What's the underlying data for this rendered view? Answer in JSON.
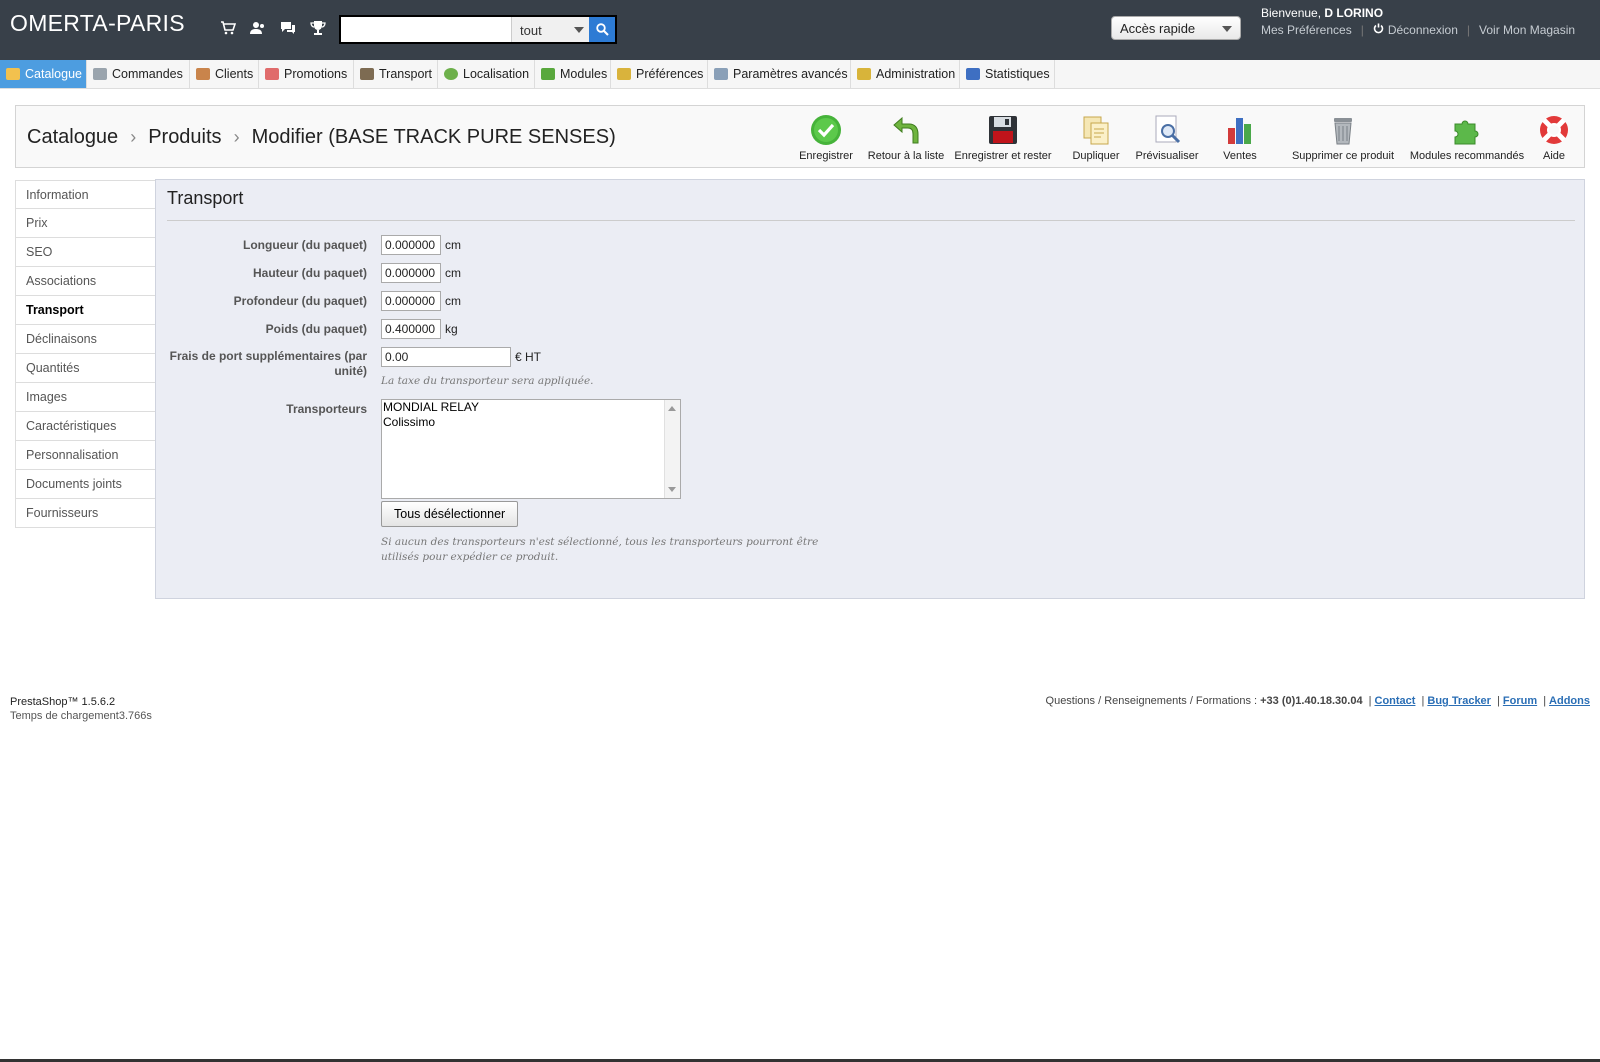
{
  "header": {
    "shop_name": "OMERTA-PARIS",
    "search_placeholder": "",
    "search_scope": "tout",
    "quick_access": "Accès rapide",
    "welcome_prefix": "Bienvenue, ",
    "user_name": "D LORINO",
    "prefs_link": "Mes Préférences",
    "logout_link": "Déconnexion",
    "shop_link": "Voir Mon Magasin",
    "icons": [
      "cart-icon",
      "customers-icon",
      "messages-icon",
      "trophy-icon"
    ]
  },
  "nav": {
    "items": [
      {
        "label": "Catalogue",
        "icon": "folder-icon",
        "color": "#f2c14e"
      },
      {
        "label": "Commandes",
        "icon": "cart-icon",
        "color": "#9aa4ad"
      },
      {
        "label": "Clients",
        "icon": "user-icon",
        "color": "#c9844b"
      },
      {
        "label": "Promotions",
        "icon": "tag-icon",
        "color": "#e06b6b"
      },
      {
        "label": "Transport",
        "icon": "truck-icon",
        "color": "#7d6b52"
      },
      {
        "label": "Localisation",
        "icon": "globe-icon",
        "color": "#6db04b"
      },
      {
        "label": "Modules",
        "icon": "puzzle-icon",
        "color": "#59a83d"
      },
      {
        "label": "Préférences",
        "icon": "wrench-icon",
        "color": "#d9b33c"
      },
      {
        "label": "Paramètres avancés",
        "icon": "tools-icon",
        "color": "#8aa0b8"
      },
      {
        "label": "Administration",
        "icon": "key-icon",
        "color": "#d8b43a"
      },
      {
        "label": "Statistiques",
        "icon": "chart-icon",
        "color": "#3e6fc2"
      }
    ]
  },
  "toolbar": {
    "breadcrumb": [
      "Catalogue",
      "Produits",
      "Modifier (BASE TRACK PURE SENSES)"
    ],
    "buttons": [
      {
        "label": "Enregistrer",
        "icon": "save-check-icon"
      },
      {
        "label": "Retour à la liste",
        "icon": "back-arrow-icon"
      },
      {
        "label": "Enregistrer et rester",
        "icon": "floppy-disk-icon"
      },
      {
        "label": "Dupliquer",
        "icon": "duplicate-icon"
      },
      {
        "label": "Prévisualiser",
        "icon": "preview-icon"
      },
      {
        "label": "Ventes",
        "icon": "sales-chart-icon"
      },
      {
        "label": "Supprimer ce produit",
        "icon": "trash-icon"
      },
      {
        "label": "Modules recommandés",
        "icon": "puzzle-icon"
      },
      {
        "label": "Aide",
        "icon": "lifebuoy-icon"
      }
    ]
  },
  "sidebar": {
    "items": [
      {
        "label": "Information"
      },
      {
        "label": "Prix"
      },
      {
        "label": "SEO"
      },
      {
        "label": "Associations"
      },
      {
        "label": "Transport"
      },
      {
        "label": "Déclinaisons"
      },
      {
        "label": "Quantités"
      },
      {
        "label": "Images"
      },
      {
        "label": "Caractéristiques"
      },
      {
        "label": "Personnalisation"
      },
      {
        "label": "Documents joints"
      },
      {
        "label": "Fournisseurs"
      }
    ],
    "active": "Transport"
  },
  "form": {
    "title": "Transport",
    "width_label": "Longueur (du paquet)",
    "width_value": "0.000000",
    "width_unit": "cm",
    "height_label": "Hauteur (du paquet)",
    "height_value": "0.000000",
    "height_unit": "cm",
    "depth_label": "Profondeur (du paquet)",
    "depth_value": "0.000000",
    "depth_unit": "cm",
    "weight_label": "Poids (du paquet)",
    "weight_value": "0.400000",
    "weight_unit": "kg",
    "extra_label": "Frais de port supplémentaires (par unité)",
    "extra_value": "0.00",
    "extra_unit": "€ HT",
    "extra_hint": "La taxe du transporteur sera appliquée.",
    "carriers_label": "Transporteurs",
    "carriers": [
      "MONDIAL RELAY",
      "Colissimo"
    ],
    "deselect_button": "Tous désélectionner",
    "carriers_hint": "Si aucun des transporteurs n'est sélectionné, tous les transporteurs pourront être utilisés pour expédier ce produit."
  },
  "footer": {
    "version": "PrestaShop™ 1.5.6.2",
    "load_time": "Temps de chargement3.766s",
    "contact_text": "Questions / Renseignements / Formations : ",
    "phone": "+33 (0)1.40.18.30.04",
    "links": [
      "Contact",
      "Bug Tracker",
      "Forum",
      "Addons"
    ]
  }
}
